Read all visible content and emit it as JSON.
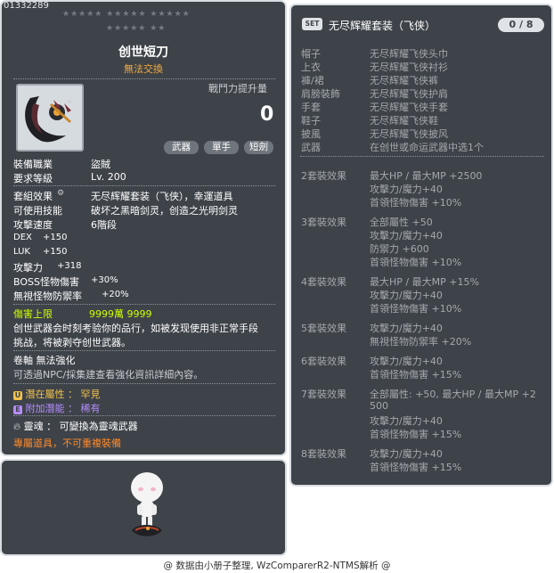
{
  "item": {
    "id": "01332289",
    "stars_row1": "★★★★★ ★★★★★ ★★★★★",
    "stars_row2": "★★★★★ ★★",
    "name": "创世短刀",
    "trade": "無法交換",
    "attack_increase_label": "戰鬥力提升量",
    "attack_increase_value": "0",
    "tags": [
      "武器",
      "單手",
      "短劍"
    ],
    "job_label": "裝備職業",
    "job_value": "盜賊",
    "level_label": "要求等級",
    "level_value": "Lv. 200",
    "set_effect_label": "套組效果",
    "set_effect_value": "无尽辉耀套装（飞侠），幸運道具",
    "skill_label": "可使用技能",
    "skill_value": "破坏之黑暗剑灵，创造之光明剑灵",
    "speed_label": "攻擊速度",
    "speed_value": "6階段",
    "stats": [
      {
        "name": "DEX",
        "value": "+150"
      },
      {
        "name": "LUK",
        "value": "+150"
      },
      {
        "name": "攻擊力",
        "value": "+318"
      },
      {
        "name": "BOSS怪物傷害",
        "value": "+30%"
      },
      {
        "name": "無視怪物防禦率",
        "value": "+20%"
      }
    ],
    "damage_cap_label": "傷害上限",
    "damage_cap_value": "9999萬 9999",
    "description": [
      "创世武器会时刻考验你的品行，如被发现使用非正常手段",
      "挑战，将被剥夺创世武器。"
    ],
    "scroll_line": "卷軸 無法強化",
    "npc_hint": "可透過NPC/採集建查看強化資訊詳細內容。",
    "potential_label": "潛在屬性",
    "potential_value": "稀有",
    "potential_grade": "罕見",
    "addl_label": "附加潛能",
    "addl_value": "稀有",
    "soul_label": "靈魂",
    "soul_value": "可變換為靈魂武器",
    "exclusive": "專屬道具，不可重複裝備"
  },
  "set": {
    "badge": "SET",
    "title": "无尽辉耀套装（飞侠）",
    "count": "0 / 8",
    "pieces": [
      {
        "slot": "帽子",
        "name": "无尽辉耀飞侠头巾"
      },
      {
        "slot": "上衣",
        "name": "无尽辉耀飞侠衬衫"
      },
      {
        "slot": "褲/裙",
        "name": "无尽辉耀飞侠裤"
      },
      {
        "slot": "肩膀裝飾",
        "name": "无尽辉耀飞侠护肩"
      },
      {
        "slot": "手套",
        "name": "无尽辉耀飞侠手套"
      },
      {
        "slot": "鞋子",
        "name": "无尽辉耀飞侠鞋"
      },
      {
        "slot": "披風",
        "name": "无尽辉耀飞侠披风"
      },
      {
        "slot": "武器",
        "name": "在创世或命运武器中选1个"
      }
    ],
    "effects": [
      {
        "label": "2套裝效果",
        "lines": [
          "最大HP / 最大MP  +2500",
          "攻擊力/魔力+40",
          "首領怪物傷害 +10%"
        ]
      },
      {
        "label": "3套裝效果",
        "lines": [
          "全部屬性 +50",
          "攻擊力/魔力+40",
          "防禦力 +600",
          "首領怪物傷害 +10%"
        ]
      },
      {
        "label": "4套裝效果",
        "lines": [
          "最大HP / 最大MP  +15%",
          "攻擊力/魔力+40",
          "首領怪物傷害 +10%"
        ]
      },
      {
        "label": "5套裝效果",
        "lines": [
          "攻擊力/魔力+40",
          "無視怪物防禦率 +20%"
        ]
      },
      {
        "label": "6套裝效果",
        "lines": [
          "攻擊力/魔力+40",
          "首領怪物傷害 +15%"
        ]
      },
      {
        "label": "7套裝效果",
        "lines": [
          "全部屬性: +50, 最大HP / 最大MP  +2",
          "500",
          "攻擊力/魔力+40",
          "首領怪物傷害 +15%"
        ]
      },
      {
        "label": "8套裝效果",
        "lines": [
          "攻擊力/魔力+40",
          "首領怪物傷害 +15%"
        ]
      }
    ]
  },
  "footer": "@ 数据由小册子整理, WzComparerR2-NTMS解析 @",
  "colors": {
    "panel_bg": "#3e4349",
    "trade": "#f2a93b",
    "damage_cap": "#ccff00",
    "exclusive": "#ff8a2a",
    "potential": "#f2c14b",
    "additional": "#b58cff"
  }
}
